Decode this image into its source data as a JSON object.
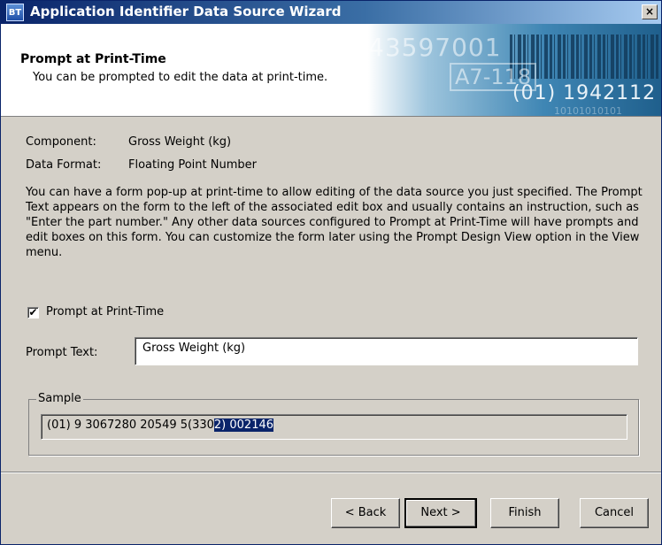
{
  "window": {
    "title": "Application Identifier Data Source Wizard",
    "icon_text": "BT",
    "close_glyph": "×"
  },
  "header": {
    "title": "Prompt at Print-Time",
    "subtitle": "You can be prompted to edit the data at print-time.",
    "banner": {
      "big_number": "43597001",
      "small_code": "A7-118",
      "code": "(01) 1942112",
      "bits": "10101010101"
    }
  },
  "info": {
    "component_label": "Component:",
    "component_value": "Gross Weight (kg)",
    "format_label": "Data Format:",
    "format_value": "Floating Point Number"
  },
  "description": "You can have a form pop-up at print-time to allow editing of the data source you just specified. The Prompt Text appears on the form to the left of the associated edit box and usually contains an instruction, such as \"Enter the part number.\" Any other data sources configured to Prompt at Print-Time will have prompts and edit boxes on this form. You can customize the form later using the Prompt Design View option in the View menu.",
  "prompt_checkbox": {
    "label": "Prompt at Print-Time",
    "checked": true,
    "mark": "✔"
  },
  "prompt_text": {
    "label": "Prompt Text:",
    "value": "Gross Weight (kg)"
  },
  "sample": {
    "group_label": "Sample",
    "value_plain": "(01) 9 3067280 20549 5(330",
    "value_selected": "2) 002146"
  },
  "buttons": {
    "back": "< Back",
    "next": "Next >",
    "finish": "Finish",
    "cancel": "Cancel"
  },
  "colors": {
    "titlebar": "#0a246a",
    "dialog_bg": "#d4d0c8",
    "selection": "#0a246a"
  }
}
